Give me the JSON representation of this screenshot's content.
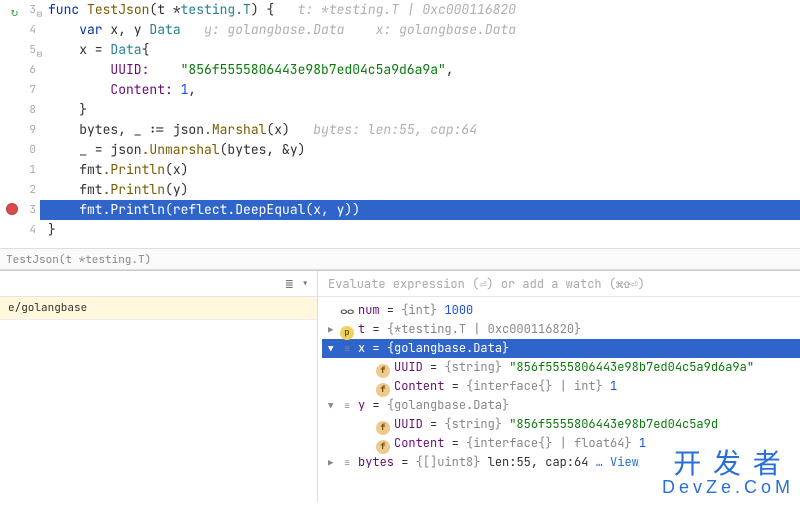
{
  "editor": {
    "line_numbers": [
      "3",
      "4",
      "5",
      "6",
      "7",
      "8",
      "9",
      "0",
      "1",
      "2",
      "3",
      "4"
    ],
    "lines": {
      "l3_kw": "func ",
      "l3_name": "TestJson",
      "l3_sig": "(t *",
      "l3_ty": "testing.T",
      "l3_close": ") {",
      "l3_hint": "   t: *testing.T | 0xc000116820",
      "l4_kw": "    var ",
      "l4_ids": "x, y ",
      "l4_ty": "Data",
      "l4_hint": "   y: golangbase.Data    x: golangbase.Data",
      "l5": "    x = ",
      "l5_ty": "Data",
      "l5_close": "{",
      "l6_field": "        UUID:    ",
      "l6_str": "\"856f5555806443e98b7ed04c5a9d6a9a\"",
      "l6_comma": ",",
      "l7_field": "        Content: ",
      "l7_num": "1",
      "l7_comma": ",",
      "l8": "    }",
      "l9_a": "    bytes, _ := ",
      "l9_pkg": "json",
      "l9_fn": ".Marshal",
      "l9_args": "(x)",
      "l9_hint": "   bytes: len:55, cap:64",
      "l10_a": "    _ = ",
      "l10_pkg": "json",
      "l10_fn": ".Unmarshal",
      "l10_args": "(bytes, &y)",
      "l11_a": "    fmt",
      "l11_fn": ".Println",
      "l11_args": "(x)",
      "l12_a": "    fmt",
      "l12_fn": ".Println",
      "l12_args": "(y)",
      "l13_a": "    fmt",
      "l13_fn": ".Println",
      "l13_args": "(reflect.DeepEqual(x, y))",
      "l14": "}"
    }
  },
  "breadcrumb": "TestJson(t *testing.T)",
  "frames": {
    "stack_row": "e/golangbase"
  },
  "watch_placeholder": "Evaluate expression (⏎) or add a watch (⌘⇧⏎)",
  "vars": {
    "num": {
      "name": "num",
      "type": "{int}",
      "value": "1000"
    },
    "t": {
      "name": "t",
      "type": "{*testing.T | 0xc000116820}"
    },
    "x": {
      "name": "x",
      "type": "{golangbase.Data}",
      "uuid": {
        "name": "UUID",
        "type": "{string}",
        "value": "\"856f5555806443e98b7ed04c5a9d6a9a\""
      },
      "content": {
        "name": "Content",
        "type": "{interface{} | int}",
        "value": "1"
      }
    },
    "y": {
      "name": "y",
      "type": "{golangbase.Data}",
      "uuid": {
        "name": "UUID",
        "type": "{string}",
        "value": "\"856f5555806443e98b7ed04c5a9d"
      },
      "content": {
        "name": "Content",
        "type": "{interface{} | float64}",
        "value": "1"
      }
    },
    "bytes": {
      "name": "bytes",
      "type": "{[]uint8}",
      "value": "len:55, cap:64",
      "view": "… View"
    }
  },
  "watermark": {
    "top": "开 发 者",
    "bottom": "DevZe.CoM"
  }
}
